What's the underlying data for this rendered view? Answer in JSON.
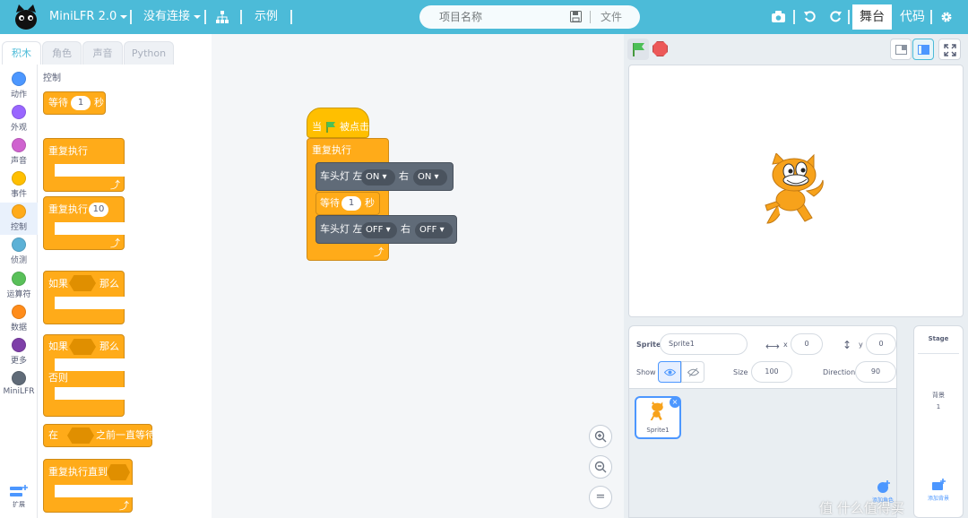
{
  "header": {
    "app_title": "MiniLFR 2.0",
    "connection": "没有连接",
    "examples": "示例",
    "project_placeholder": "项目名称",
    "file_menu": "文件",
    "stage_tab": "舞台",
    "code_tab": "代码",
    "colors": {
      "bar": "#4cbbd8"
    }
  },
  "tabs": [
    "积木",
    "角色",
    "声音",
    "Python"
  ],
  "categories": [
    {
      "label": "动作",
      "color": "#4c97ff"
    },
    {
      "label": "外观",
      "color": "#9966ff"
    },
    {
      "label": "声音",
      "color": "#cf63cf"
    },
    {
      "label": "事件",
      "color": "#ffbf00"
    },
    {
      "label": "控制",
      "color": "#ffab19"
    },
    {
      "label": "侦测",
      "color": "#5cb1d6"
    },
    {
      "label": "运算符",
      "color": "#59c059"
    },
    {
      "label": "数据",
      "color": "#ff8c1a"
    },
    {
      "label": "更多",
      "color": "#7e3fa8"
    },
    {
      "label": "MiniLFR",
      "color": "#606b78"
    }
  ],
  "extensions_label": "扩展",
  "palette": {
    "section": "控制",
    "wait_label": "等待",
    "wait_value": "1",
    "wait_unit": "秒",
    "forever": "重复执行",
    "repeat": "重复执行",
    "repeat_value": "10",
    "if_label": "如果",
    "then_label": "那么",
    "if2_label": "如果",
    "then2_label": "那么",
    "else_label": "否则",
    "wait_until_pre": "在",
    "wait_until_post": "之前一直等待",
    "repeat_until": "重复执行直到"
  },
  "script": {
    "hat_pre": "当",
    "hat_post": "被点击",
    "forever": "重复执行",
    "cmd1": {
      "label": "车头灯 左",
      "left": "ON",
      "right_label": "右",
      "right": "ON"
    },
    "wait": {
      "label": "等待",
      "value": "1",
      "unit": "秒"
    },
    "cmd2": {
      "label": "车头灯 左",
      "left": "OFF",
      "right_label": "右",
      "right": "OFF"
    }
  },
  "zoom": {
    "reset": "="
  },
  "sprite_info": {
    "sprite_label": "Sprite",
    "sprite_name": "Sprite1",
    "x_label": "x",
    "x_value": "0",
    "y_label": "y",
    "y_value": "0",
    "show_label": "Show",
    "size_label": "Size",
    "size_value": "100",
    "direction_label": "Direction",
    "direction_value": "90"
  },
  "sprites": [
    {
      "name": "Sprite1"
    }
  ],
  "stage_panel": {
    "title": "Stage",
    "backdrops_label": "背景",
    "backdrops_count": "1"
  },
  "add_sprite": "添加角色",
  "add_backdrop": "添加背景",
  "watermark": "值 什么值得买"
}
